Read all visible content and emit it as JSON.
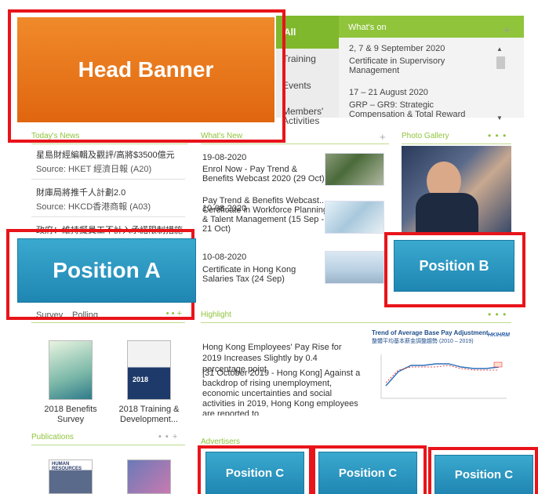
{
  "top_nav": {
    "items": [
      "All",
      "Training",
      "Events",
      "Members' Activities"
    ]
  },
  "whats_on": {
    "title": "What's on",
    "plus": "+",
    "event1_date": "2, 7 & 9 September 2020",
    "event1_title": "Certificate in Supervisory Management",
    "event2_date": "17 – 21 August 2020",
    "event2_title": "GRP – GR9: Strategic Compensation & Total Reward"
  },
  "todays_news": {
    "title": "Today's News",
    "items": [
      {
        "headline": "星島財經編輯及觀評/高將$3500億元",
        "source": "Source: HKET 經濟日報 (A20)"
      },
      {
        "headline": "財庫局將推千人計劃2.0",
        "source": "Source: HKCD香港商報 (A03)"
      },
      {
        "headline": "政府：維持擬員工不計入承諾限制措施",
        "source": ""
      }
    ]
  },
  "whats_new": {
    "title": "What's New",
    "plus": "+",
    "items": [
      {
        "date": "19-08-2020",
        "title": "Enrol Now - Pay Trend & Benefits Webcast 2020 (29 Oct)"
      },
      {
        "date": "10-08-2020",
        "title": "Pay Trend & Benefits Webcast... Certificate in Workforce Planning & Talent Management (15 Sep - 21 Oct)"
      },
      {
        "date": "10-08-2020",
        "title": "Certificate in Hong Kong Salaries Tax (24 Sep)"
      }
    ]
  },
  "photo_gallery": {
    "title": "Photo Gallery",
    "dots": "• • •"
  },
  "survey": {
    "tab_survey": "Survey",
    "tab_polling": "Polling",
    "dots": "• • +",
    "book1_caption": "2018 Benefits Survey",
    "book2_caption": "2018 Training & Development...",
    "book2_cover_label": "2018"
  },
  "highlight": {
    "title": "Highlight",
    "dots": "• • •",
    "headline": "Hong Kong Employees' Pay Rise for 2019 Increases Slightly by 0.4 percentage point",
    "body": "[31 October 2019 - Hong Kong] Against a backdrop of rising unemployment, economic uncertainties and social activities in 2019, Hong Kong employees are reported to",
    "chart_title": "Trend of Average Base Pay Adjustment",
    "chart_subtitle": "整體平均基本薪金調整趨勢 (2010 – 2019)",
    "chart_logo": "HKIHRM"
  },
  "publications": {
    "title": "Publications",
    "dots": "• • +",
    "book1_label": "HUMAN RESOURCES"
  },
  "advertisers": {
    "title": "Advertisers"
  },
  "callouts": {
    "head_banner": "Head Banner",
    "position_a": "Position A",
    "position_b": "Position B",
    "position_c1": "Position C",
    "position_c2": "Position C",
    "position_c3": "Position C"
  },
  "colors": {
    "accent_green": "#8fc43b",
    "callout_red": "#e8141a",
    "banner_orange": "#e8751a",
    "position_blue": "#2b98c3"
  }
}
